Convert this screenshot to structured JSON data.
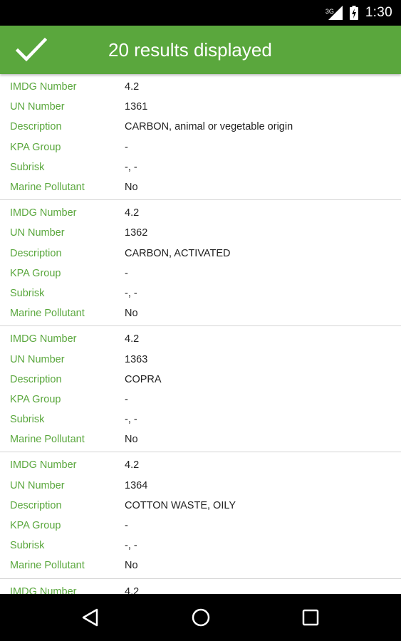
{
  "status_bar": {
    "network": "3G",
    "time": "1:30",
    "icons": [
      "signal-icon",
      "battery-icon"
    ]
  },
  "toolbar": {
    "confirm_icon": "check-icon",
    "title": "20 results displayed",
    "color": "#5aa73d"
  },
  "labels": {
    "imdg": "IMDG Number",
    "un": "UN Number",
    "description": "Description",
    "kpa": "KPA Group",
    "subrisk": "Subrisk",
    "marine": "Marine Pollutant"
  },
  "results": [
    {
      "imdg": "4.2",
      "un": "1361",
      "description": "CARBON, animal or vegetable origin",
      "kpa": "-",
      "subrisk": "-, -",
      "marine": "No"
    },
    {
      "imdg": "4.2",
      "un": "1362",
      "description": "CARBON, ACTIVATED",
      "kpa": "-",
      "subrisk": "-, -",
      "marine": "No"
    },
    {
      "imdg": "4.2",
      "un": "1363",
      "description": "COPRA",
      "kpa": "-",
      "subrisk": "-, -",
      "marine": "No"
    },
    {
      "imdg": "4.2",
      "un": "1364",
      "description": "COTTON WASTE, OILY",
      "kpa": "-",
      "subrisk": "-, -",
      "marine": "No"
    },
    {
      "imdg": "4.2"
    }
  ],
  "nav_bar": {
    "icons": [
      "back-icon",
      "home-icon",
      "recents-icon"
    ]
  }
}
